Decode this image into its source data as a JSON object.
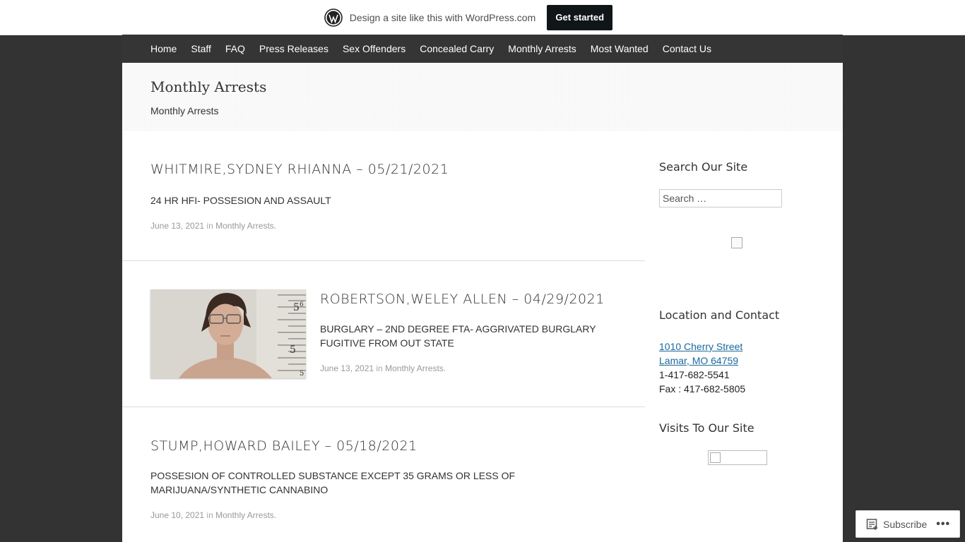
{
  "wpbar": {
    "text": "Design a site like this with WordPress.com",
    "button": "Get started"
  },
  "nav": {
    "items": [
      "Home",
      "Staff",
      "FAQ",
      "Press Releases",
      "Sex Offenders",
      "Concealed Carry",
      "Monthly Arrests",
      "Most Wanted",
      "Contact Us"
    ]
  },
  "header": {
    "title": "Monthly Arrests",
    "description": "Monthly Arrests"
  },
  "posts": [
    {
      "title": "WHITMIRE,SYDNEY RHIANNA – 05/21/2021",
      "excerpt": "24 HR HFI- POSSESION AND ASSAULT",
      "date": "June 13, 2021",
      "in": "in",
      "category": "Monthly Arrests."
    },
    {
      "title": "ROBERTSON,WELEY ALLEN – 04/29/2021",
      "excerpt": "BURGLARY – 2ND DEGREE FTA- AGGRIVATED BURGLARY FUGITIVE FROM OUT STATE",
      "date": "June 13, 2021",
      "in": "in",
      "category": "Monthly Arrests.",
      "height_marks": [
        "5",
        "6",
        "5",
        "5"
      ]
    },
    {
      "title": "STUMP,HOWARD BAILEY – 05/18/2021",
      "excerpt": "POSSESION OF CONTROLLED SUBSTANCE EXCEPT 35 GRAMS OR LESS OF MARIJUANA/SYNTHETIC CANNABINO",
      "date": "June 10, 2021",
      "in": "in",
      "category": "Monthly Arrests."
    }
  ],
  "sidebar": {
    "search_title": "Search Our Site",
    "search_placeholder": "Search …",
    "location_title": "Location and Contact",
    "address_line1": "1010 Cherry Street",
    "address_line2": "Lamar, MO 64759",
    "phone": "1-417-682-5541",
    "fax": "Fax : 417-682-5805",
    "visits_title": "Visits To Our Site"
  },
  "subscribe": {
    "label": "Subscribe",
    "more": "•••"
  },
  "colors": {
    "background": "#333333",
    "link": "#1a6a9c",
    "button": "#101517"
  }
}
